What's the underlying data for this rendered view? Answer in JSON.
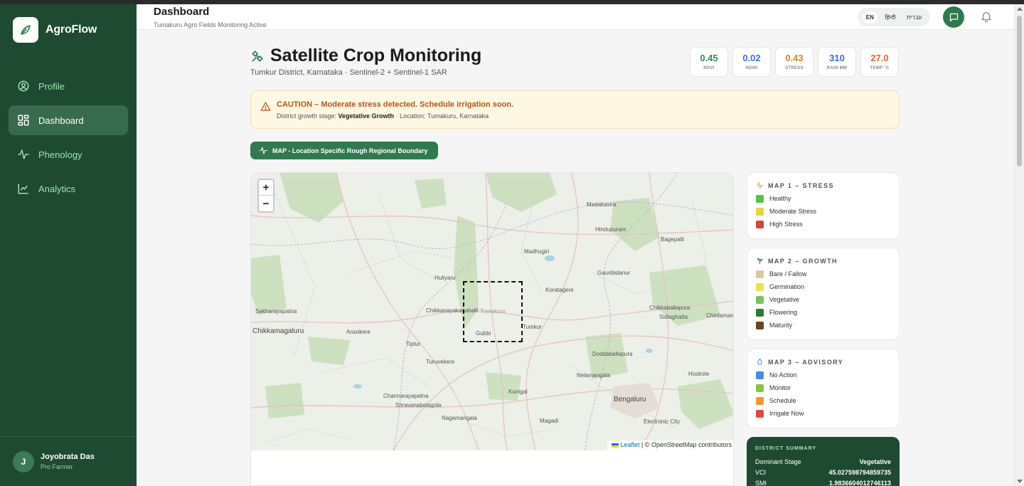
{
  "app": {
    "name": "AgroFlow"
  },
  "sidebar": {
    "items": [
      {
        "label": "Profile",
        "icon": "user-circle-icon"
      },
      {
        "label": "Dashboard",
        "icon": "dashboard-grid-icon",
        "active": true
      },
      {
        "label": "Phenology",
        "icon": "activity-pulse-icon"
      },
      {
        "label": "Analytics",
        "icon": "line-chart-icon"
      }
    ],
    "user": {
      "initial": "J",
      "name": "Joyobrata Das",
      "role": "Pro Farmer"
    }
  },
  "header": {
    "title": "Dashboard",
    "subtitle": "Tumakuru Agro Fields Monitoring Active",
    "languages": [
      "EN",
      "हिन्दी",
      "עברית"
    ],
    "selected_language": "EN"
  },
  "page": {
    "title": "Satellite Crop Monitoring",
    "subtitle": "Tumkur District, Karnataka · Sentinel-2 + Sentinel-1 SAR"
  },
  "metrics": [
    {
      "value": "0.45",
      "label": "NDVI",
      "color": "#2e8b57"
    },
    {
      "value": "0.02",
      "label": "NDWI",
      "color": "#3b6fd6"
    },
    {
      "value": "0.43",
      "label": "STRESS",
      "color": "#d5812b"
    },
    {
      "value": "310",
      "label": "RAIN MM",
      "color": "#3b6fd6"
    },
    {
      "value": "27.0",
      "label": "TEMP °C",
      "color": "#e0662f"
    }
  ],
  "alert": {
    "title": "CAUTION – Moderate stress detected. Schedule irrigation soon.",
    "stage_prefix": "District growth stage: ",
    "stage": "Vegetative Growth",
    "location": " · Location: Tumakuru, Karnataka"
  },
  "map_button": {
    "label": "MAP - Location Specific Rough Regional Boundary"
  },
  "map": {
    "zoom_in": "+",
    "zoom_out": "−",
    "attribution_leaflet": "Leaflet",
    "attribution_rest": " | © OpenStreetMap contributors",
    "towns": [
      "Madakasira",
      "Hindupuram",
      "Bagepalli",
      "Madhugiri",
      "Gauribidanur",
      "Huliyaru",
      "Koratagere",
      "Chikkanayakanahalli",
      "Tumakuru",
      "Chikkaballapura",
      "Sidlaghatta",
      "Chintamani",
      "Sakharayapatna",
      "Chikkamagaluru",
      "Arasikere",
      "Tiptur",
      "Gubbi",
      "Tumkur",
      "Doddaballapura",
      "Turuvekere",
      "Nelamangala",
      "Hoskote",
      "Kunigal",
      "Bengaluru",
      "Channarayapatna",
      "Shravanabelagola",
      "Nagamangala",
      "Electronic City",
      "Magadi"
    ]
  },
  "legends": {
    "stress": {
      "title": "MAP 1 – STRESS",
      "items": [
        {
          "label": "Healthy",
          "color": "#5cbf48"
        },
        {
          "label": "Moderate Stress",
          "color": "#e8d53c"
        },
        {
          "label": "High Stress",
          "color": "#d9453a"
        }
      ]
    },
    "growth": {
      "title": "MAP 2 – GROWTH",
      "items": [
        {
          "label": "Bare / Fallow",
          "color": "#d8c9a6"
        },
        {
          "label": "Germination",
          "color": "#eee34f"
        },
        {
          "label": "Vegetative",
          "color": "#77c465"
        },
        {
          "label": "Flowering",
          "color": "#2e7a36"
        },
        {
          "label": "Maturity",
          "color": "#6a4420"
        }
      ]
    },
    "advisory": {
      "title": "MAP 3 – ADVISORY",
      "items": [
        {
          "label": "No Action",
          "color": "#4a8be0"
        },
        {
          "label": "Monitor",
          "color": "#8dc249"
        },
        {
          "label": "Schedule",
          "color": "#f0982e"
        },
        {
          "label": "Irrigate Now",
          "color": "#dd4b3e"
        }
      ]
    }
  },
  "summary": {
    "title": "DISTRICT SUMMARY",
    "rows": [
      {
        "key": "Dominant Stage",
        "value": "Vegetative"
      },
      {
        "key": "VCI",
        "value": "45.027598794859735"
      },
      {
        "key": "SMI",
        "value": "1.9836604012746113"
      }
    ]
  }
}
